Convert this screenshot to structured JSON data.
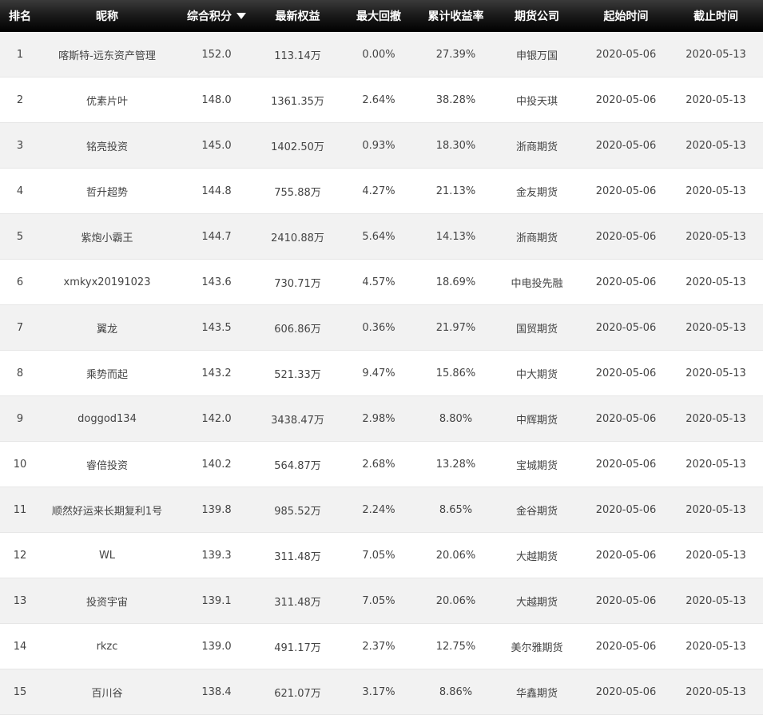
{
  "headers": {
    "rank": "排名",
    "nickname": "昵称",
    "score": "综合积分",
    "equity": "最新权益",
    "drawdown": "最大回撤",
    "return": "累计收益率",
    "company": "期货公司",
    "start": "起始时间",
    "end": "截止时间"
  },
  "sort_icon": "sort-desc-triangle-icon",
  "rows": [
    {
      "rank": "1",
      "nickname": "喀斯特-远东资产管理",
      "score": "152.0",
      "equity": "113.14万",
      "drawdown": "0.00%",
      "return": "27.39%",
      "company": "申银万国",
      "start": "2020-05-06",
      "end": "2020-05-13"
    },
    {
      "rank": "2",
      "nickname": "优素片叶",
      "score": "148.0",
      "equity": "1361.35万",
      "drawdown": "2.64%",
      "return": "38.28%",
      "company": "中投天琪",
      "start": "2020-05-06",
      "end": "2020-05-13"
    },
    {
      "rank": "3",
      "nickname": "铭亮投资",
      "score": "145.0",
      "equity": "1402.50万",
      "drawdown": "0.93%",
      "return": "18.30%",
      "company": "浙商期货",
      "start": "2020-05-06",
      "end": "2020-05-13"
    },
    {
      "rank": "4",
      "nickname": "哲升超势",
      "score": "144.8",
      "equity": "755.88万",
      "drawdown": "4.27%",
      "return": "21.13%",
      "company": "金友期货",
      "start": "2020-05-06",
      "end": "2020-05-13"
    },
    {
      "rank": "5",
      "nickname": "紫炮小霸王",
      "score": "144.7",
      "equity": "2410.88万",
      "drawdown": "5.64%",
      "return": "14.13%",
      "company": "浙商期货",
      "start": "2020-05-06",
      "end": "2020-05-13"
    },
    {
      "rank": "6",
      "nickname": "xmkyx20191023",
      "score": "143.6",
      "equity": "730.71万",
      "drawdown": "4.57%",
      "return": "18.69%",
      "company": "中电投先融",
      "start": "2020-05-06",
      "end": "2020-05-13"
    },
    {
      "rank": "7",
      "nickname": "翼龙",
      "score": "143.5",
      "equity": "606.86万",
      "drawdown": "0.36%",
      "return": "21.97%",
      "company": "国贸期货",
      "start": "2020-05-06",
      "end": "2020-05-13"
    },
    {
      "rank": "8",
      "nickname": "乘势而起",
      "score": "143.2",
      "equity": "521.33万",
      "drawdown": "9.47%",
      "return": "15.86%",
      "company": "中大期货",
      "start": "2020-05-06",
      "end": "2020-05-13"
    },
    {
      "rank": "9",
      "nickname": "doggod134",
      "score": "142.0",
      "equity": "3438.47万",
      "drawdown": "2.98%",
      "return": "8.80%",
      "company": "中辉期货",
      "start": "2020-05-06",
      "end": "2020-05-13"
    },
    {
      "rank": "10",
      "nickname": "睿倍投资",
      "score": "140.2",
      "equity": "564.87万",
      "drawdown": "2.68%",
      "return": "13.28%",
      "company": "宝城期货",
      "start": "2020-05-06",
      "end": "2020-05-13"
    },
    {
      "rank": "11",
      "nickname": "顺然好运来长期复利1号",
      "score": "139.8",
      "equity": "985.52万",
      "drawdown": "2.24%",
      "return": "8.65%",
      "company": "金谷期货",
      "start": "2020-05-06",
      "end": "2020-05-13"
    },
    {
      "rank": "12",
      "nickname": "WL",
      "score": "139.3",
      "equity": "311.48万",
      "drawdown": "7.05%",
      "return": "20.06%",
      "company": "大越期货",
      "start": "2020-05-06",
      "end": "2020-05-13"
    },
    {
      "rank": "13",
      "nickname": "投资宇宙",
      "score": "139.1",
      "equity": "311.48万",
      "drawdown": "7.05%",
      "return": "20.06%",
      "company": "大越期货",
      "start": "2020-05-06",
      "end": "2020-05-13"
    },
    {
      "rank": "14",
      "nickname": "rkzc",
      "score": "139.0",
      "equity": "491.17万",
      "drawdown": "2.37%",
      "return": "12.75%",
      "company": "美尔雅期货",
      "start": "2020-05-06",
      "end": "2020-05-13"
    },
    {
      "rank": "15",
      "nickname": "百川谷",
      "score": "138.4",
      "equity": "621.07万",
      "drawdown": "3.17%",
      "return": "8.86%",
      "company": "华鑫期货",
      "start": "2020-05-06",
      "end": "2020-05-13"
    }
  ]
}
